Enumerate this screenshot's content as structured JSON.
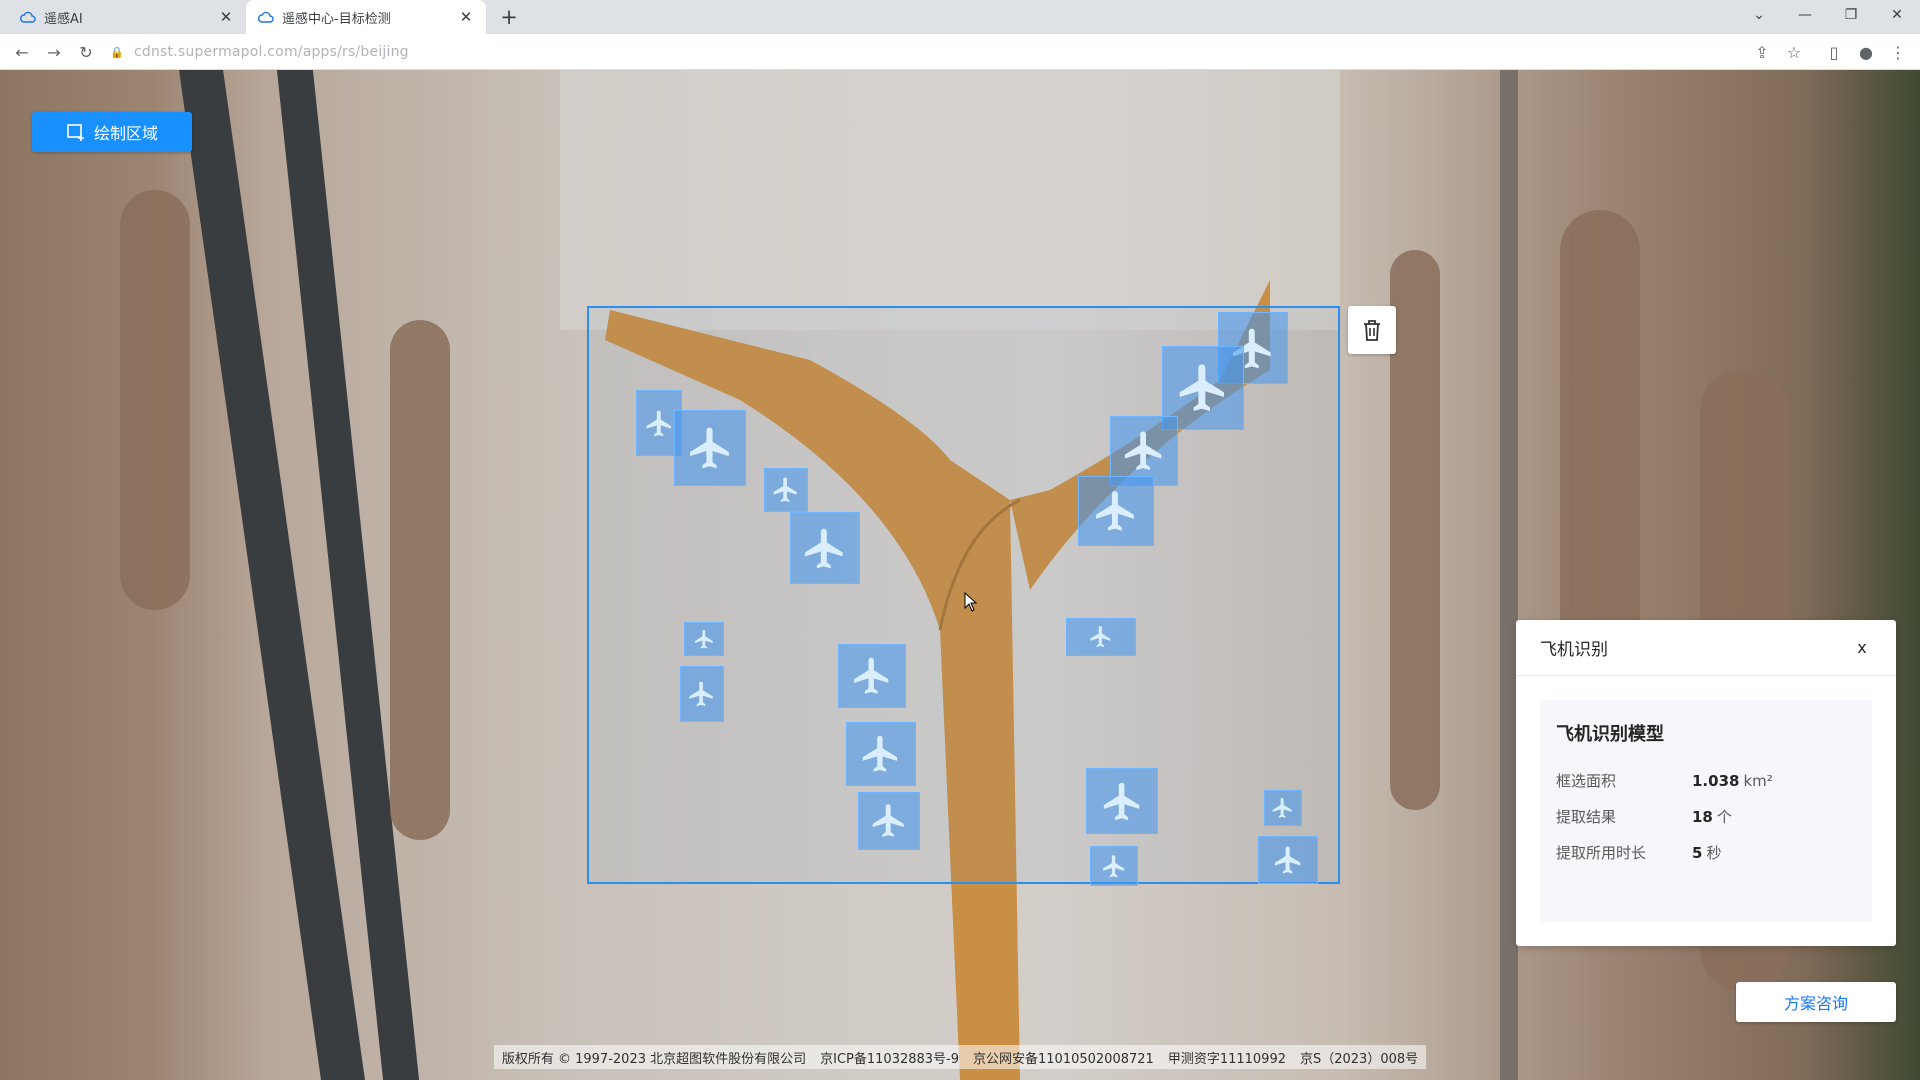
{
  "browser": {
    "tabs": [
      {
        "title": "遥感AI",
        "active": false
      },
      {
        "title": "遥感中心-目标检测",
        "active": true
      }
    ],
    "url": "cdnst.supermapol.com/apps/rs/beijing"
  },
  "map": {
    "draw_button_label": "绘制区域",
    "delete_icon": "trash-icon",
    "detections_count": 18
  },
  "panel": {
    "title": "飞机识别",
    "close_label": "x",
    "model_name": "飞机识别模型",
    "stats": [
      {
        "label": "框选面积",
        "value": "1.038",
        "unit": "km²"
      },
      {
        "label": "提取结果",
        "value": "18",
        "unit": "个"
      },
      {
        "label": "提取所用时长",
        "value": "5",
        "unit": "秒"
      }
    ]
  },
  "consult_button_label": "方案咨询",
  "footer": {
    "items": [
      "版权所有 © 1997-2023 北京超图软件股份有限公司",
      "京ICP备11032883号-9",
      "京公网安备11010502008721",
      "甲测资字11110992",
      "京S（2023）008号"
    ]
  },
  "colors": {
    "accent": "#1890ff",
    "selection": "#2b8ff0",
    "detection": "#4296f0",
    "terminal": "#c98f45"
  }
}
